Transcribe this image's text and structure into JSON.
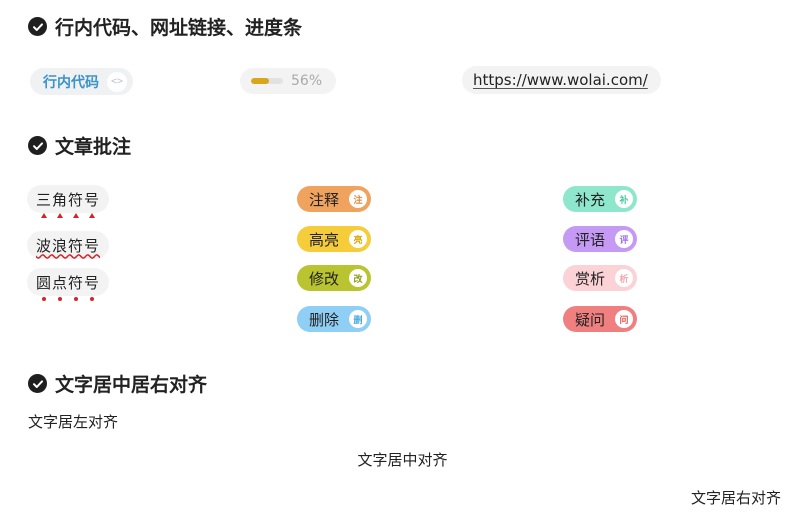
{
  "sections": {
    "inline": {
      "title": "行内代码、网址链接、进度条"
    },
    "annotation": {
      "title": "文章批注"
    },
    "alignment": {
      "title": "文字居中居右对齐"
    }
  },
  "inline_code": {
    "text": "行内代码",
    "icon": "code-icon",
    "icon_glyph": "<>"
  },
  "progress": {
    "value": 0.56,
    "label": "56%",
    "color": "#d8a61d"
  },
  "link": {
    "url": "https://www.wolai.com/"
  },
  "marks": {
    "triangle": "三角符号",
    "wavy": "波浪符号",
    "dot": "圆点符号",
    "mark_color": "#d4232b"
  },
  "pills": {
    "note": {
      "label": "注释",
      "badge": "注",
      "color": "#f0a35e",
      "badge_color": "#e08a3c"
    },
    "highlight": {
      "label": "高亮",
      "badge": "亮",
      "color": "#f5cd3a",
      "badge_color": "#d9a800"
    },
    "revise": {
      "label": "修改",
      "badge": "改",
      "color": "#b9c430",
      "badge_color": "#8e9a12"
    },
    "delete": {
      "label": "删除",
      "badge": "删",
      "color": "#8fcff5",
      "badge_color": "#4aa8e0"
    },
    "supplement": {
      "label": "补充",
      "badge": "补",
      "color": "#8ee6cc",
      "badge_color": "#48c9a3"
    },
    "comment": {
      "label": "评语",
      "badge": "评",
      "color": "#c59af5",
      "badge_color": "#a06ee8"
    },
    "appreciate": {
      "label": "赏析",
      "badge": "析",
      "color": "#fbd2d5",
      "badge_color": "#f3a8ae"
    },
    "question": {
      "label": "疑问",
      "badge": "问",
      "color": "#f08080",
      "badge_color": "#e05a5a"
    }
  },
  "alignment": {
    "left": "文字居左对齐",
    "center": "文字居中对齐",
    "right": "文字居右对齐"
  }
}
